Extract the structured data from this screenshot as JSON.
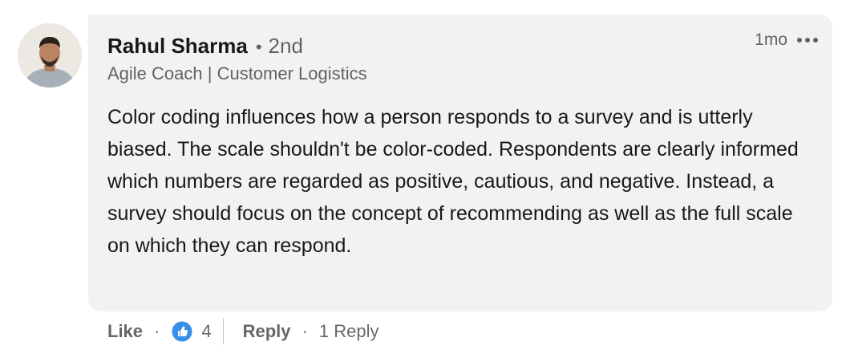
{
  "comment": {
    "author": {
      "name": "Rahul Sharma",
      "separator": "•",
      "degree": "2nd",
      "headline": "Agile Coach | Customer Logistics"
    },
    "timestamp": "1mo",
    "more_icon": "more-horizontal-icon",
    "text": "Color coding influences how a person responds to a survey and is utterly biased. The scale shouldn't be color-coded. Respondents are clearly informed which numbers are regarded as positive, cautious, and negative. Instead, a survey should focus on the concept of recommending as well as the full scale on which they can respond."
  },
  "actions": {
    "like_label": "Like",
    "separator": "·",
    "reaction_icon": "thumbs-up-icon",
    "reaction_count": "4",
    "reply_label": "Reply",
    "replies_label": "1 Reply"
  },
  "colors": {
    "bubble_bg": "#f2f2f2",
    "like_blue": "#378fe9"
  }
}
